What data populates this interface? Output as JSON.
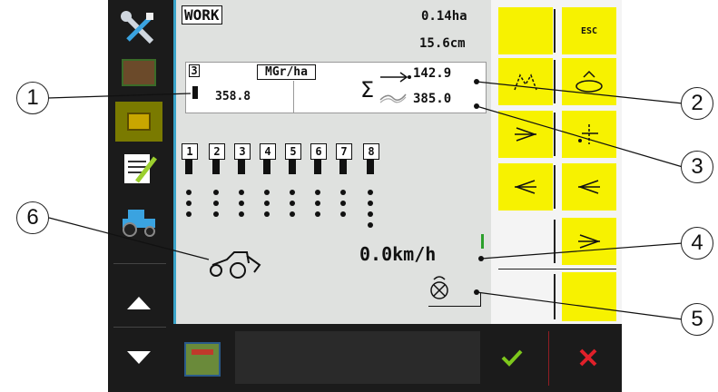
{
  "header": {
    "mode": "WORK",
    "area": "0.14ha",
    "depth": "15.6cm"
  },
  "rate_box": {
    "row_number": "3",
    "unit": "MGr/ha",
    "current_rate": "358.8",
    "sum_symbol": "Σ",
    "value_target": "142.9",
    "value_actual": "385.0"
  },
  "rows": {
    "numbers": [
      "1",
      "2",
      "3",
      "4",
      "5",
      "6",
      "7",
      "8"
    ]
  },
  "speed": "0.0km/h",
  "right_panel": {
    "esc_label": "ESC"
  },
  "callouts": [
    "1",
    "2",
    "3",
    "4",
    "5",
    "6"
  ],
  "icons": {
    "tools": "tools-icon",
    "seeder": "seeder-icon",
    "machine": "machine-icon",
    "checklist": "checklist-icon",
    "tractor": "tractor-icon",
    "arrow_up": "arrow-up-icon",
    "arrow_down": "arrow-down-icon",
    "confirm": "checkmark-icon",
    "cancel": "close-icon"
  },
  "colors": {
    "accent_yellow": "#f7f200",
    "screen_bg": "#dfe1df",
    "frame": "#1b1b1b",
    "confirm": "#7ec81c",
    "cancel": "#e0202a"
  }
}
